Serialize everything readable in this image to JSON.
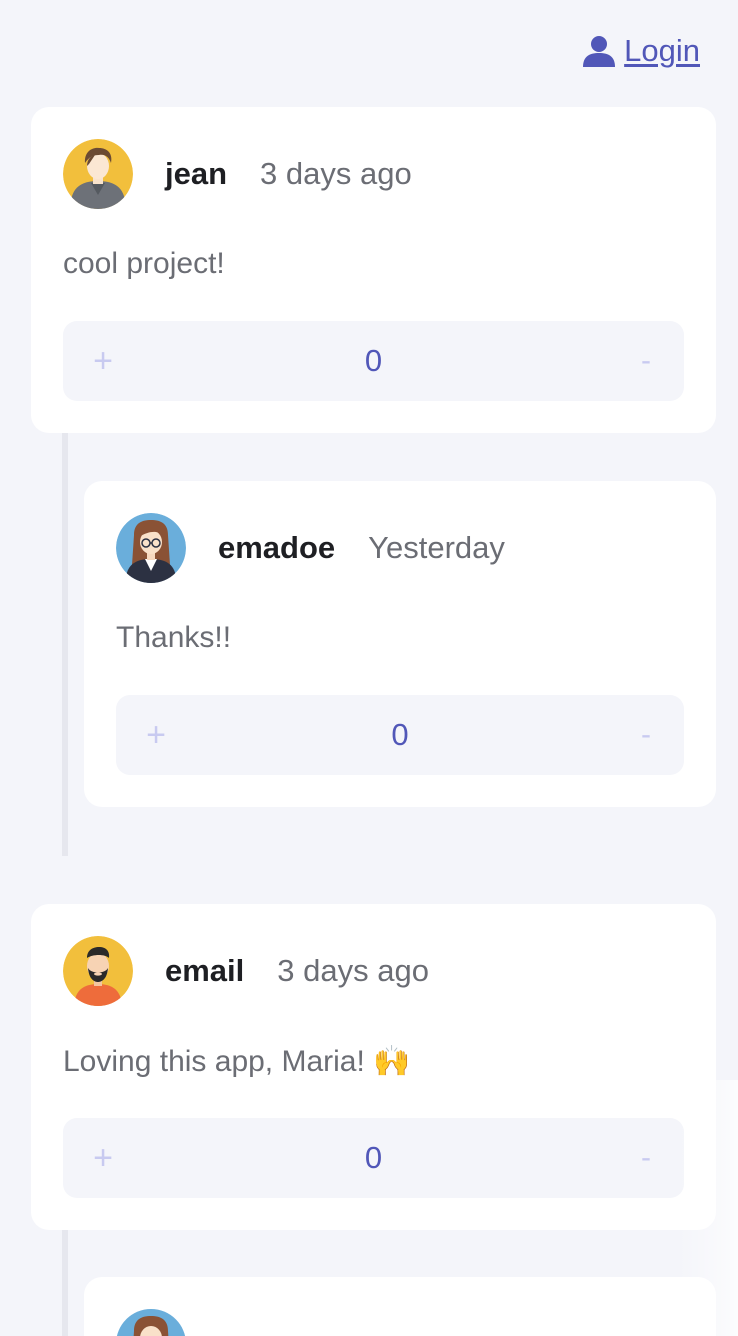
{
  "header": {
    "login_label": "Login",
    "login_icon": "user-icon"
  },
  "colors": {
    "accent": "#5157b8",
    "background": "#f4f5fa",
    "card": "#ffffff",
    "vote_button": "#c8caf0",
    "muted_text": "#6b6d74"
  },
  "comments": [
    {
      "username": "jean",
      "time": "3 days ago",
      "text": "cool project!",
      "score": "0",
      "plus_label": "+",
      "minus_label": "-",
      "avatar": "avatar-man-hoodie"
    },
    {
      "username": "emadoe",
      "time": "Yesterday",
      "text": "Thanks!!",
      "score": "0",
      "plus_label": "+",
      "minus_label": "-",
      "avatar": "avatar-woman-glasses"
    },
    {
      "username": "email",
      "time": "3 days ago",
      "text": "Loving this app, Maria! 🙌",
      "score": "0",
      "plus_label": "+",
      "minus_label": "-",
      "avatar": "avatar-man-beard"
    }
  ]
}
